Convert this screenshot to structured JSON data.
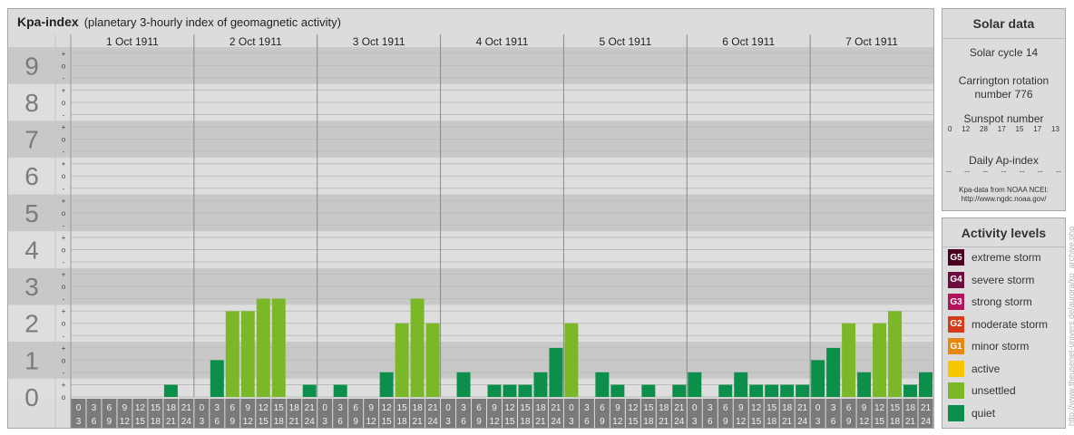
{
  "header": {
    "title": "Kpa-index",
    "subtitle": "(planetary 3-hourly index of geomagnetic activity)"
  },
  "chart_data": {
    "type": "bar",
    "title": "Kpa-index",
    "subtitle": "(planetary 3-hourly index of geomagnetic activity)",
    "ylim": [
      0,
      9
    ],
    "yticks": [
      "0",
      "1",
      "2",
      "3",
      "4",
      "5",
      "6",
      "7",
      "8",
      "9"
    ],
    "ysub_labels": [
      "-",
      "o",
      "+"
    ],
    "days": [
      "1 Oct 1911",
      "2 Oct 1911",
      "3 Oct 1911",
      "4 Oct 1911",
      "5 Oct 1911",
      "6 Oct 1911",
      "7 Oct 1911"
    ],
    "interval_labels": [
      [
        "0",
        "3"
      ],
      [
        "3",
        "6"
      ],
      [
        "6",
        "9"
      ],
      [
        "9",
        "12"
      ],
      [
        "12",
        "15"
      ],
      [
        "15",
        "18"
      ],
      [
        "18",
        "21"
      ],
      [
        "21",
        "24"
      ]
    ],
    "values": [
      [
        0,
        0,
        0,
        0,
        0,
        0,
        0.33,
        0
      ],
      [
        0,
        1,
        2.33,
        2.33,
        2.67,
        2.67,
        0,
        0.33
      ],
      [
        0,
        0.33,
        0,
        0,
        0.67,
        2,
        2.67,
        2
      ],
      [
        0,
        0.67,
        0,
        0.33,
        0.33,
        0.33,
        0.67,
        1.33
      ],
      [
        2,
        0,
        0.67,
        0.33,
        0,
        0.33,
        0,
        0.33
      ],
      [
        0.67,
        0,
        0.33,
        0.67,
        0.33,
        0.33,
        0.33,
        0.33
      ],
      [
        1,
        1.33,
        2,
        0.67,
        2,
        2.33,
        0.33,
        0.67
      ]
    ],
    "grid": true
  },
  "colors": {
    "panel_bg": "#dcdcdc",
    "band_dark": "#c8c8c8",
    "band_light": "#dedede",
    "axis_digit": "#7b7b7b",
    "time_cell": "#7a7a7a",
    "quiet": "#0d8f4c",
    "unsettled": "#7ab828",
    "active": "#f7c600",
    "minor": "#e8870d",
    "moderate": "#d53b1a",
    "strong": "#b3125c",
    "severe": "#6b0d3e",
    "extreme": "#4a0021"
  },
  "solar": {
    "title": "Solar data",
    "cycle": "Solar cycle 14",
    "carrington_line1": "Carrington rotation",
    "carrington_line2": "number 776",
    "sunspot_label": "Sunspot number",
    "sunspots": [
      "0",
      "12",
      "28",
      "17",
      "15",
      "17",
      "13"
    ],
    "ap_label": "Daily Ap-index",
    "ap_values": [
      "--",
      "--",
      "--",
      "--",
      "--",
      "--",
      "--"
    ],
    "source_line1": "Kpa-data from NOAA NCEI:",
    "source_line2": "http://www.ngdc.noaa.gov/"
  },
  "activity": {
    "title": "Activity levels",
    "levels": [
      {
        "code": "G5",
        "label": "extreme storm",
        "color": "#4a0021"
      },
      {
        "code": "G4",
        "label": "severe storm",
        "color": "#6b0d3e"
      },
      {
        "code": "G3",
        "label": "strong storm",
        "color": "#b3125c"
      },
      {
        "code": "G2",
        "label": "moderate storm",
        "color": "#d53b1a"
      },
      {
        "code": "G1",
        "label": "minor storm",
        "color": "#e8870d"
      },
      {
        "code": "",
        "label": "active",
        "color": "#f7c600"
      },
      {
        "code": "",
        "label": "unsettled",
        "color": "#7ab828"
      },
      {
        "code": "",
        "label": "quiet",
        "color": "#0d8f4c"
      }
    ]
  },
  "watermark": "http://www.theusenet-univers.de/aurora/kp_archive.php"
}
